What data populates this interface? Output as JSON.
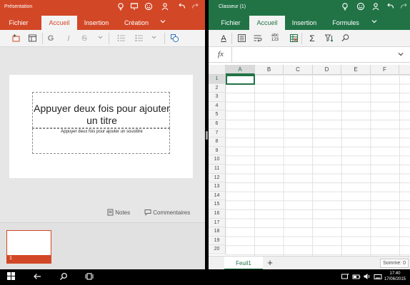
{
  "powerpoint": {
    "window_title": "Présentation",
    "accent": "#d24726",
    "tabs": [
      {
        "label": "Fichier"
      },
      {
        "label": "Accueil"
      },
      {
        "label": "Insertion"
      },
      {
        "label": "Création"
      }
    ],
    "ribbon_icons": [
      "new-slide-icon",
      "layout-icon",
      "bold-icon",
      "italic-icon",
      "strikethrough-icon",
      "chevron-down-icon",
      "bullets-icon",
      "numbering-icon",
      "chevron-down-icon",
      "shapes-icon"
    ],
    "ribbon_glyphs": {
      "bold": "G",
      "italic": "I",
      "strike": "S"
    },
    "slide": {
      "title_placeholder": "Appuyer deux fois pour ajouter un titre",
      "subtitle_placeholder": "Appuyer deux fois pour ajouter un soustitre"
    },
    "status": {
      "notes": "Notes",
      "comments": "Commentaires"
    },
    "thumbnails": [
      {
        "number": "1"
      }
    ]
  },
  "excel": {
    "window_title": "Classeur (1)",
    "accent": "#217346",
    "tabs": [
      {
        "label": "Fichier"
      },
      {
        "label": "Accueil"
      },
      {
        "label": "Insertion"
      },
      {
        "label": "Formules"
      }
    ],
    "ribbon_icons": [
      "font-color-icon",
      "align-icon",
      "wrap-text-icon",
      "number-format-icon",
      "table-format-icon",
      "sum-icon",
      "sort-filter-icon",
      "find-icon"
    ],
    "ribbon_glyphs": {
      "font": "A",
      "number_format": "abc\n123"
    },
    "formula_bar": {
      "fx": "fx",
      "value": ""
    },
    "columns": [
      "A",
      "B",
      "C",
      "D",
      "E",
      "F"
    ],
    "rows": [
      "1",
      "2",
      "3",
      "4",
      "5",
      "6",
      "7",
      "8",
      "9",
      "10",
      "11",
      "12",
      "13",
      "14",
      "15",
      "16",
      "17",
      "18",
      "19",
      "20"
    ],
    "selected_cell": "A1",
    "sheets": [
      {
        "name": "Feuil1"
      }
    ],
    "add_sheet": "+",
    "status_sum": "Somme: 0"
  },
  "taskbar": {
    "icons": [
      "start-icon",
      "back-icon",
      "search-icon",
      "task-view-icon",
      "notification-icons"
    ],
    "time": "17:40",
    "date": "17/06/2015"
  }
}
